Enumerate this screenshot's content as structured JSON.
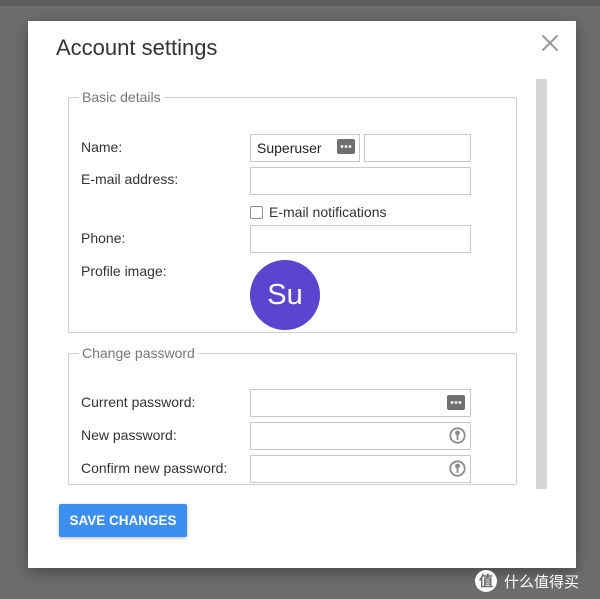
{
  "dialog": {
    "title": "Account settings"
  },
  "basic_details": {
    "legend": "Basic details",
    "name_label": "Name:",
    "first_name_value": "Superuser",
    "last_name_value": "",
    "email_label": "E-mail address:",
    "email_value": "",
    "email_notifications_label": "E-mail notifications",
    "email_notifications_checked": false,
    "phone_label": "Phone:",
    "phone_value": "",
    "profile_image_label": "Profile image:",
    "avatar_initials": "Su"
  },
  "change_password": {
    "legend": "Change password",
    "current_label": "Current password:",
    "current_value": "",
    "new_label": "New password:",
    "new_value": "",
    "confirm_label": "Confirm new password:",
    "confirm_value": ""
  },
  "actions": {
    "save_label": "SAVE CHANGES"
  },
  "watermark": {
    "text": "什么值得买"
  },
  "colors": {
    "accent": "#3d8ef1",
    "avatar_bg": "#5c44cf",
    "backdrop": "#6d6d6d"
  },
  "icons": {
    "close": "close-icon",
    "password_manager": "password-manager-icon",
    "key": "key-icon",
    "logo": "watermark-logo-icon"
  }
}
